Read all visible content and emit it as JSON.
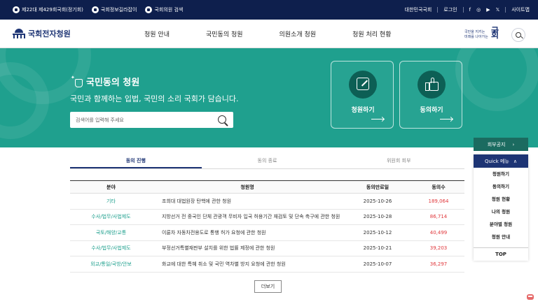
{
  "topbar": {
    "links": [
      {
        "label": "제22대 제429회국회(정기회)",
        "icon": "session-icon"
      },
      {
        "label": "국회정보길라잡이",
        "icon": "guide-icon"
      },
      {
        "label": "국회의원 검색",
        "icon": "member-search-icon"
      }
    ],
    "right": {
      "assembly": "대한민국국회",
      "login": "로그인",
      "sitemap": "사이트맵"
    },
    "social": [
      "f",
      "◎",
      "▶",
      "𝕏"
    ]
  },
  "header": {
    "logo": "국회전자청원",
    "nav": [
      "청원 안내",
      "국민동의 청원",
      "의원소개 청원",
      "청원 처리 현황"
    ],
    "badge_line1": "국민을 지키는",
    "badge_line2": "미래를 나아가는",
    "badge_mark": "국회"
  },
  "hero": {
    "title": "국민동의 청원",
    "subtitle": "국민과 함께하는 입법, 국민의 소리 국회가 담습니다.",
    "search_placeholder": "검색어를 입력해 주세요",
    "card_petition": "청원하기",
    "card_agree": "동의하기"
  },
  "tabs": [
    "동의 진행",
    "동의 종료",
    "위원회 회부"
  ],
  "table": {
    "headers": [
      "분야",
      "청원명",
      "동의만료일",
      "동의수"
    ],
    "rows": [
      {
        "category": "기타",
        "title": "조희대 대법원장 탄핵에 관한 청원",
        "date": "2025-10-26",
        "count": "189,064"
      },
      {
        "category": "수사/법무/사법제도",
        "title": "지방선거 전 중국인 단체 관광객 무비자 입국 허용기간 재검토 및 단속 촉구에 관한 청원",
        "date": "2025-10-28",
        "count": "86,714"
      },
      {
        "category": "국토/해양/교통",
        "title": "이륜차 자동차전용도로 통행 허가 요청에 관한 청원",
        "date": "2025-10-12",
        "count": "40,499"
      },
      {
        "category": "수사/법무/사법제도",
        "title": "부정선거특별재판부 설치를 위한 법률 제정에 관한 청원",
        "date": "2025-10-21",
        "count": "39,203"
      },
      {
        "category": "외교/통일/국방/안보",
        "title": "화교에 대한 특혜 취소 및 국민 역차별 방지 요청에 관한 청원",
        "date": "2025-10-07",
        "count": "36,297"
      }
    ]
  },
  "more_label": "더보기",
  "side": {
    "notice": "회부공지",
    "notice_arrow": "›",
    "quick_title": "Quick 메뉴",
    "quick_arrow": "∧",
    "items": [
      "청원하기",
      "동의하기",
      "청원 현황",
      "나의 청원",
      "분야별 청원",
      "청원 안내"
    ],
    "top": "TOP"
  },
  "colors": {
    "navy": "#0e1f4d",
    "teal": "#1fa08e",
    "count_red": "#e0373b"
  }
}
